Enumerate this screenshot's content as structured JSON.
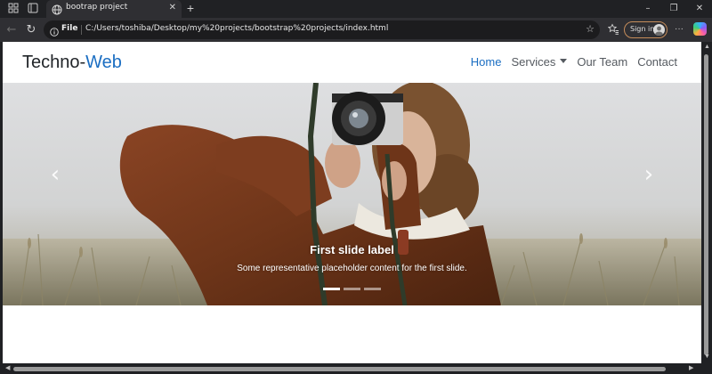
{
  "browser": {
    "tab": {
      "title": "bootrap project",
      "close_label": "✕"
    },
    "new_tab_label": "+",
    "window_controls": {
      "minimize": "–",
      "restore": "❐",
      "close": "✕"
    },
    "address": {
      "scheme_label": "File",
      "url": "C:/Users/toshiba/Desktop/my%20projects/bootstrap%20projects/index.html"
    },
    "sign_in_label": "Sign in",
    "more_label": "···",
    "icons": {
      "workspaces": "workspaces-icon",
      "tab_actions": "tab-actions-icon",
      "back": "back-arrow-icon",
      "refresh": "refresh-icon",
      "favorite": "star-icon",
      "favorites": "favorites-icon",
      "copilot": "copilot-icon"
    }
  },
  "site": {
    "brand": {
      "main": "Techno-",
      "accent": "Web"
    },
    "nav": [
      {
        "label": "Home",
        "active": true
      },
      {
        "label": "Services",
        "dropdown": true
      },
      {
        "label": "Our Team"
      },
      {
        "label": "Contact"
      }
    ],
    "carousel": {
      "prev_label": "‹",
      "next_label": "›",
      "caption_title": "First slide label",
      "caption_text": "Some representative placeholder content for the first slide.",
      "slide_count": 3,
      "active_index": 0
    }
  },
  "colors": {
    "brand_accent": "#1b6ec2",
    "chrome_bg": "#202124",
    "toolbar_bg": "#2f2f33"
  }
}
